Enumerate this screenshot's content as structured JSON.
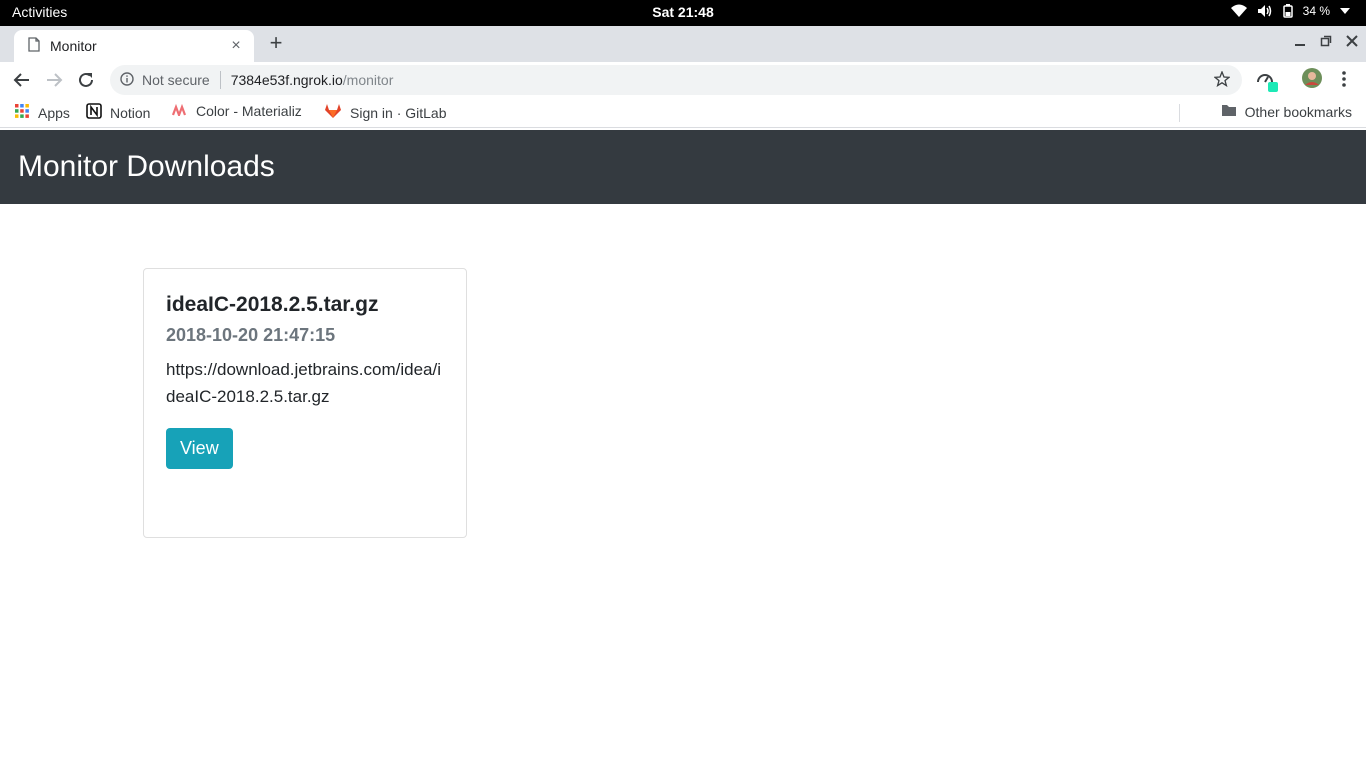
{
  "system": {
    "activities": "Activities",
    "clock": "Sat 21:48",
    "battery": "34 %"
  },
  "browser": {
    "tab": {
      "title": "Monitor",
      "close": "×"
    },
    "new_tab": "+",
    "address": {
      "security_label": "Not secure",
      "host": "7384e53f.ngrok.io",
      "path": "/monitor"
    },
    "bookmarks": [
      {
        "label": "Apps",
        "icon": "apps-grid-icon"
      },
      {
        "label": "Notion",
        "icon": "notion-icon"
      },
      {
        "label": "Color - Materializ",
        "icon": "materialize-icon"
      },
      {
        "label": "Sign in · GitLab",
        "icon": "gitlab-icon"
      }
    ],
    "other_bookmarks": "Other bookmarks"
  },
  "page": {
    "header_title": "Monitor Downloads",
    "card": {
      "title": "ideaIC-2018.2.5.tar.gz",
      "subtitle": "2018-10-20 21:47:15",
      "url": "https://download.jetbrains.com/idea/ideaIC-2018.2.5.tar.gz",
      "button_label": "View"
    }
  },
  "colors": {
    "header_bg": "#343a40",
    "button_bg": "#17a2b8",
    "subtitle": "#6c757d"
  }
}
